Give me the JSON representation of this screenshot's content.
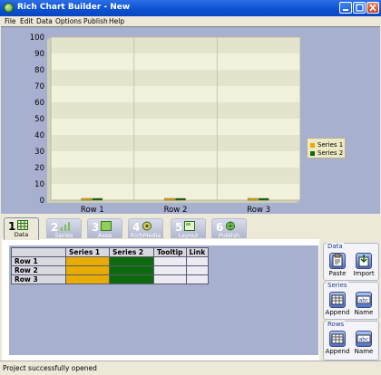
{
  "window": {
    "title": "Rich Chart Builder - New"
  },
  "menu": [
    "File",
    "Edit",
    "Data",
    "Options",
    "Publish",
    "Help"
  ],
  "chart_data": {
    "type": "bar",
    "categories": [
      "Row 1",
      "Row 2",
      "Row 3"
    ],
    "series": [
      {
        "name": "Series 1",
        "values": [
          0,
          0,
          0
        ],
        "color": "#e8ac00"
      },
      {
        "name": "Series 2",
        "values": [
          0,
          0,
          0
        ],
        "color": "#0f6a0f"
      }
    ],
    "ylim": [
      0,
      100
    ],
    "yticks": [
      0,
      10,
      20,
      30,
      40,
      50,
      60,
      70,
      80,
      90,
      100
    ],
    "grid": true,
    "legend_position": "right",
    "plot_bands": [
      "#f2f2dc",
      "#e4e4cc"
    ]
  },
  "tabs": [
    {
      "num": "1",
      "label": "Data",
      "icon": "grid-icon",
      "active": true
    },
    {
      "num": "2",
      "label": "Series",
      "icon": "bars-icon",
      "active": false
    },
    {
      "num": "3",
      "label": "Axes",
      "icon": "axes-icon",
      "active": false
    },
    {
      "num": "4",
      "label": "RichMedia",
      "icon": "richmedia-icon",
      "active": false
    },
    {
      "num": "5",
      "label": "Layout",
      "icon": "layout-icon",
      "active": false
    },
    {
      "num": "6",
      "label": "Publish",
      "icon": "publish-icon",
      "active": false
    }
  ],
  "grid": {
    "columns": [
      "Series 1",
      "Series 2",
      "Tooltip",
      "Link"
    ],
    "rows": [
      "Row 1",
      "Row 2",
      "Row 3"
    ],
    "cell_colors": [
      "#e8ac00",
      "#0f6a0f",
      "#eceaf2",
      "#eceaf2"
    ]
  },
  "side": {
    "data": {
      "title": "Data",
      "buttons": [
        {
          "label": "Paste",
          "icon": "paste-icon"
        },
        {
          "label": "Import",
          "icon": "import-icon"
        }
      ]
    },
    "series": {
      "title": "Series",
      "buttons": [
        {
          "label": "Append",
          "icon": "append-column-icon"
        },
        {
          "label": "Name",
          "icon": "name-icon"
        }
      ]
    },
    "rows": {
      "title": "Rows",
      "buttons": [
        {
          "label": "Append",
          "icon": "append-row-icon"
        },
        {
          "label": "Name",
          "icon": "name-icon"
        }
      ]
    }
  },
  "status": {
    "text": "Project successfully opened"
  }
}
